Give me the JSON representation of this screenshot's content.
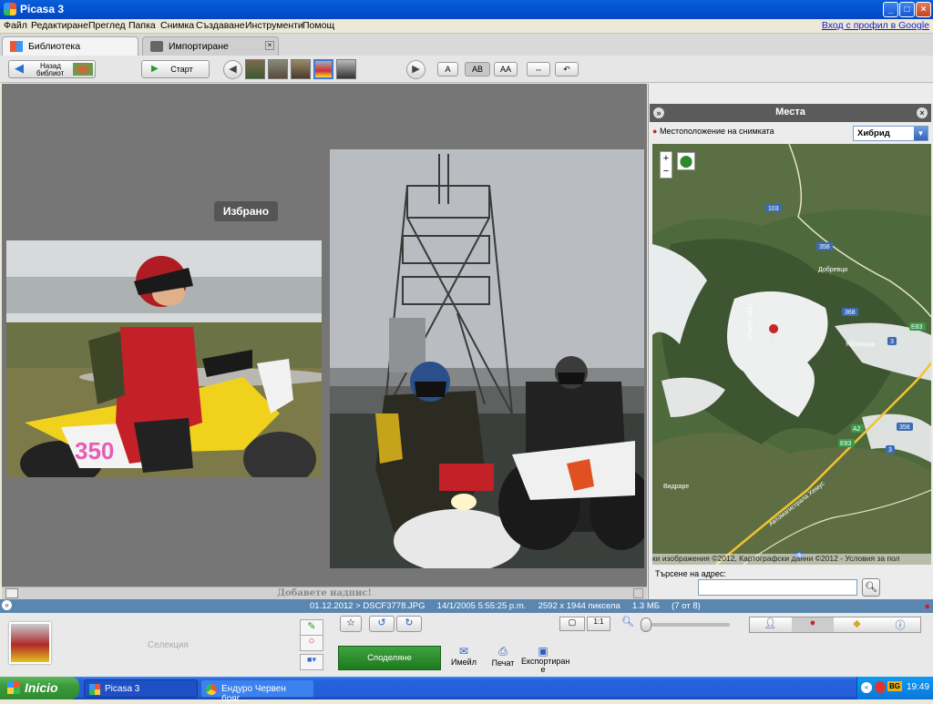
{
  "window": {
    "title": "Picasa 3"
  },
  "menu": {
    "items": [
      "Файл",
      "Редактиране",
      "Преглед",
      "Папка",
      "Снимка",
      "Създаване",
      "Инструменти",
      "Помощ"
    ],
    "google_sign_in": "Вход с профил в Google"
  },
  "tabs": [
    {
      "label": "Библиотека"
    },
    {
      "label": "Импортиране"
    }
  ],
  "toolbar": {
    "back_label_line1": "Назад",
    "back_label_line2": "библиот",
    "start_label": "Старт",
    "caption_a": "A",
    "caption_ab": "AB",
    "caption_aa": "AA"
  },
  "main": {
    "selected_label": "Избрано",
    "caption_placeholder": "Добавете надпис!"
  },
  "status": {
    "text": "01.12.2012 > DSCF3778.JPG     14/1/2005 5:55:25 p.m.     2592 x 1944 пиксела     1.3 МБ     (7 от 8)"
  },
  "places": {
    "title": "Места",
    "photo_location": "Местоположение на снимката",
    "map_type": "Хибрид",
    "zoom_in": "+",
    "zoom_out": "−",
    "road_labels": [
      "103",
      "358",
      "368",
      "E83",
      "3",
      "A2",
      "E83",
      "358",
      "3",
      "3"
    ],
    "place_labels": [
      "Добревци",
      "Ябланица",
      "Видраре",
      "Автомагистрала Хемус"
    ],
    "peak_label": "Порт Сабъл",
    "copyright": "ки изображения ©2012, Картографски данни ©2012 - Условия за пол",
    "search_label": "Търсене на адрес:",
    "search_value": ""
  },
  "bottom": {
    "selection_label": "Селекция",
    "share_label": "Споделяне",
    "email_label": "Имейл",
    "print_label": "Печат",
    "export_label_line1": "Експортиран",
    "export_label_line2": "е"
  },
  "taskbar": {
    "start": "Inicio",
    "tasks": [
      "Picasa 3",
      "Ендуро Червен бряг..."
    ],
    "time": "19:49",
    "lang": "BG"
  }
}
